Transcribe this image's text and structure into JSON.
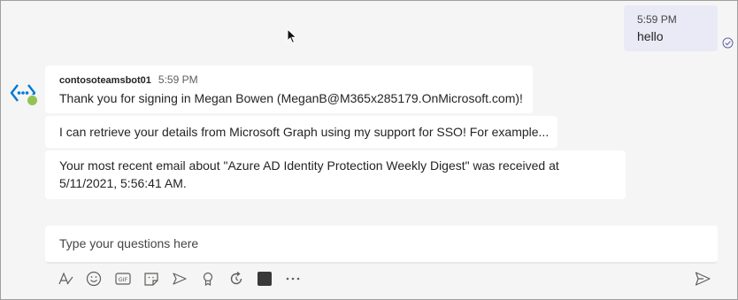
{
  "outgoing": {
    "time": "5:59 PM",
    "text": "hello"
  },
  "bot": {
    "name": "contosoteamsbot01",
    "time": "5:59 PM",
    "messages": [
      "Thank you for signing in Megan Bowen (MeganB@M365x285179.OnMicrosoft.com)!",
      "I can retrieve your details from Microsoft Graph using my support for SSO! For example...",
      "Your most recent email about \"Azure AD Identity Protection Weekly Digest\" was received at 5/11/2021, 5:56:41 AM."
    ]
  },
  "compose": {
    "placeholder": "Type your questions here"
  },
  "toolbar": {
    "icons": [
      "format-icon",
      "emoji-icon",
      "gif-icon",
      "sticker-icon",
      "meet-now-icon",
      "praise-icon",
      "loop-icon",
      "app-icon",
      "more-options-icon"
    ],
    "gif_label": "GIF",
    "more_label": "···"
  },
  "colors": {
    "outgoing_bubble": "#e9eaf6",
    "accent": "#6264a7",
    "presence": "#92c353",
    "bot_logo": "#0078d4"
  }
}
